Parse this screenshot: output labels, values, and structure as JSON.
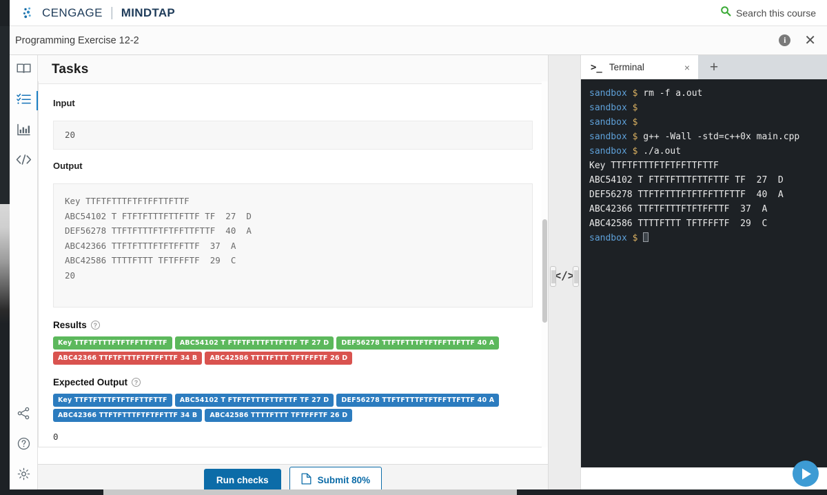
{
  "brand": {
    "logo_icon": "cengage-logo-icon",
    "cengage": "CENGAGE",
    "separator": "|",
    "mindtap": "MINDTAP",
    "search_icon": "search-icon",
    "search_label": "Search this course",
    "search_icon_color": "#3aaa35"
  },
  "titlebar": {
    "exercise_title": "Programming Exercise 12-2",
    "info_icon": "info-icon",
    "info_glyph": "i",
    "close_icon": "close-icon",
    "close_glyph": "✕"
  },
  "rail": {
    "items": [
      {
        "name": "ebook-icon",
        "active": false
      },
      {
        "name": "checklist-icon",
        "active": true
      },
      {
        "name": "bar-chart-icon",
        "active": false
      },
      {
        "name": "code-icon",
        "active": false
      }
    ],
    "bottom_items": [
      {
        "name": "share-icon"
      },
      {
        "name": "help-icon"
      },
      {
        "name": "settings-icon"
      }
    ]
  },
  "tasks": {
    "heading": "Tasks",
    "input_label": "Input",
    "input_value": "20",
    "output_label": "Output",
    "output_text": "Key TTFTFTTTFTFTFFTTFTTF\nABC54102 T FTFTFTTTFTTFTTF TF  27  D\nDEF56278 TTFTFTTTFTFTFFTTFTTF  40  A\nABC42366 TTFTFTTTFTFTFFTTF  37  A\nABC42586 TTTTFTTT TFTFFFTF  29  C\n20",
    "results": {
      "title": "Results",
      "help_icon": "help-circle-icon",
      "rows": [
        [
          {
            "text": "Key TTFTFTTTFTFTFFTTFTTF",
            "status": "pass"
          },
          {
            "text": "ABC54102 T FTFTFTTTFTTFTTF TF  27  D",
            "status": "pass"
          },
          {
            "text": "DEF56278 TTFTFTTTFTFTFFTTFTTF  40  A",
            "status": "pass"
          }
        ],
        [
          {
            "text": "ABC42366 TTFTFTTTFTFTFFTTF  34  B",
            "status": "fail"
          },
          {
            "text": "ABC42586 TTTTFTTT TFTFFFTF  26  D",
            "status": "fail"
          }
        ]
      ]
    },
    "expected": {
      "title": "Expected Output",
      "help_icon": "help-circle-icon",
      "rows": [
        [
          {
            "text": "Key TTFTFTTTFTFTFFTTFTTF"
          },
          {
            "text": "ABC54102 T FTFTFTTTFTTFTTF TF  27  D"
          },
          {
            "text": "DEF56278 TTFTFTTTFTFTFFTTFTTF  40  A"
          }
        ],
        [
          {
            "text": "ABC42366 TTFTFTTTFTFTFFTTF  34  B"
          },
          {
            "text": "ABC42586 TTTTFTTT TFTFFFTF  26  D"
          }
        ]
      ]
    },
    "trailing_value": "0"
  },
  "splitter": {
    "icon": "code-icon",
    "glyph": "</>"
  },
  "terminal": {
    "tab_prompt_glyph": ">_",
    "tab_name": "Terminal",
    "tab_close_glyph": "×",
    "add_tab_glyph": "+",
    "lines": [
      {
        "host": "sandbox",
        "dollar": "$",
        "cmd": " rm -f a.out",
        "type": "cmd"
      },
      {
        "host": "sandbox",
        "dollar": "$",
        "cmd": "",
        "type": "cmd"
      },
      {
        "host": "sandbox",
        "dollar": "$",
        "cmd": "",
        "type": "cmd"
      },
      {
        "host": "sandbox",
        "dollar": "$",
        "cmd": " g++ -Wall -std=c++0x main.cpp",
        "type": "cmd"
      },
      {
        "host": "sandbox",
        "dollar": "$",
        "cmd": " ./a.out",
        "type": "cmd"
      },
      {
        "out": "Key TTFTFTTTFTFTFFTTFTTF",
        "type": "out"
      },
      {
        "out": "ABC54102 T FTFTFTTTFTTFTTF TF  27  D",
        "type": "out"
      },
      {
        "out": "DEF56278 TTFTFTTTFTFTFFTTFTTF  40  A",
        "type": "out"
      },
      {
        "out": "ABC42366 TTFTFTTTFTFTFFTTF  37  A",
        "type": "out"
      },
      {
        "out": "ABC42586 TTTTFTTT TFTFFFTF  29  C",
        "type": "out"
      },
      {
        "host": "sandbox",
        "dollar": "$",
        "cmd": "",
        "type": "prompt-cursor"
      }
    ]
  },
  "bottombar": {
    "run_label": "Run checks",
    "submit_icon": "document-icon",
    "submit_label": "Submit 80%"
  },
  "play": {
    "icon": "play-icon",
    "color": "#3d9bd4"
  }
}
